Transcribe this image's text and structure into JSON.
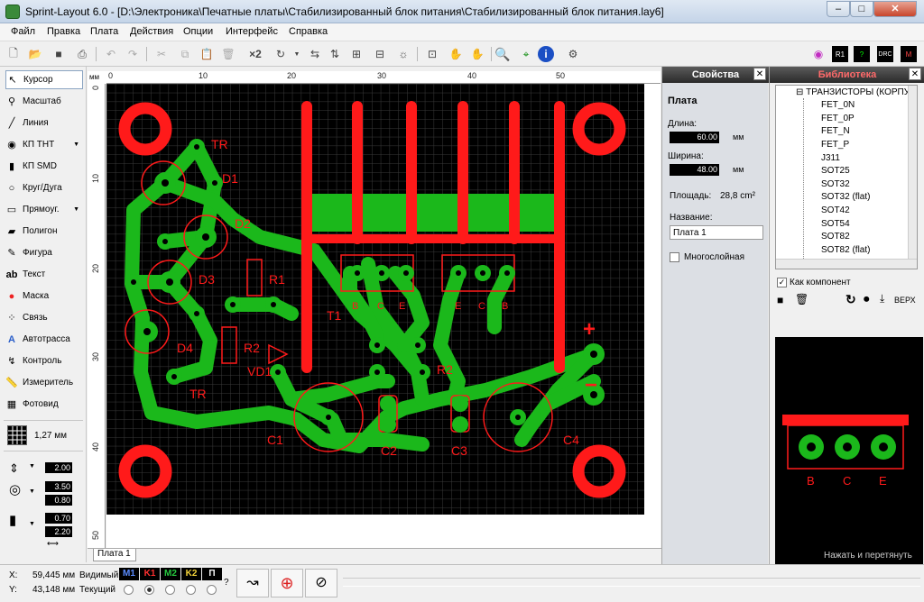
{
  "window": {
    "title": "Sprint-Layout 6.0 - [D:\\Электроника\\Печатные платы\\Стабилизированный блок питания\\Стабилизированный блок питания.lay6]"
  },
  "menu": [
    "Файл",
    "Правка",
    "Плата",
    "Действия",
    "Опции",
    "Интерфейс",
    "Справка"
  ],
  "toolbar": {
    "zoom_x2": "×2"
  },
  "tools": [
    {
      "label": "Курсор",
      "icon": "cursor-icon"
    },
    {
      "label": "Масштаб",
      "icon": "zoom-icon"
    },
    {
      "label": "Линия",
      "icon": "line-icon"
    },
    {
      "label": "КП ТНТ",
      "icon": "pad-tht-icon"
    },
    {
      "label": "КП SMD",
      "icon": "pad-smd-icon"
    },
    {
      "label": "Круг/Дуга",
      "icon": "circle-arc-icon"
    },
    {
      "label": "Прямоуг.",
      "icon": "rectangle-icon"
    },
    {
      "label": "Полигон",
      "icon": "polygon-icon"
    },
    {
      "label": "Фигура",
      "icon": "figure-icon"
    },
    {
      "label": "Текст",
      "icon": "text-icon"
    },
    {
      "label": "Маска",
      "icon": "mask-icon"
    },
    {
      "label": "Связь",
      "icon": "connection-icon"
    },
    {
      "label": "Автотрасса",
      "icon": "autoroute-icon"
    },
    {
      "label": "Контроль",
      "icon": "check-icon"
    },
    {
      "label": "Измеритель",
      "icon": "measure-icon"
    },
    {
      "label": "Фотовид",
      "icon": "photoview-icon"
    }
  ],
  "grid": {
    "value": "1,27 мм"
  },
  "track_width": "2.00",
  "pad_outer": "3.50",
  "pad_inner": "0.80",
  "smd_width": "0.70",
  "smd_height": "2.20",
  "ruler": {
    "unit": "мм",
    "top": [
      "0",
      "10",
      "20",
      "30",
      "40",
      "50"
    ],
    "left": [
      "0",
      "10",
      "20",
      "30",
      "40",
      "50"
    ]
  },
  "board_tab": "Плата 1",
  "properties": {
    "header": "Свойства",
    "section": "Плата",
    "length_label": "Длина:",
    "length_value": "60.00",
    "width_label": "Ширина:",
    "width_value": "48.00",
    "unit": "мм",
    "area_label": "Площадь:",
    "area_value": "28,8 cm²",
    "name_label": "Название:",
    "name_value": "Плата 1",
    "multilayer_label": "Многослойная"
  },
  "library": {
    "header": "Библиотека",
    "group": "ТРАНЗИСТОРЫ (КОРПУ",
    "items": [
      "FET_0N",
      "FET_0P",
      "FET_N",
      "FET_P",
      "J311",
      "SOT25",
      "SOT32",
      "SOT32 (flat)",
      "SOT42",
      "SOT54",
      "SOT82",
      "SOT82 (flat)"
    ],
    "as_component_label": "Как компонент",
    "side_label": "ВЕРХ",
    "hint": "Нажать и перетянуть",
    "pin_labels": [
      "B",
      "C",
      "E"
    ]
  },
  "status": {
    "x_label": "X:",
    "x_value": "59,445 мм",
    "y_label": "Y:",
    "y_value": "43,148 мм",
    "visible_label": "Видимый",
    "current_label": "Текущий",
    "layers": [
      {
        "name": "M1",
        "color": "#5b8cff"
      },
      {
        "name": "K1",
        "color": "#ff3030"
      },
      {
        "name": "M2",
        "color": "#27c93f"
      },
      {
        "name": "K2",
        "color": "#f2d23a"
      },
      {
        "name": "П",
        "color": "#ffffff"
      }
    ],
    "question": "?"
  },
  "pcb": {
    "labels": [
      "TR",
      "D1",
      "D2",
      "D3",
      "D4",
      "TR",
      "R1",
      "R2",
      "VD1",
      "T1",
      "B",
      "C",
      "E",
      "E",
      "C",
      "B",
      "R2",
      "C1",
      "C2",
      "C3",
      "C4",
      "+",
      "−"
    ],
    "colors": {
      "copper": "#1bb81b",
      "silk": "#ff1a1a",
      "background": "#000000",
      "grid": "#3a3a3a"
    }
  }
}
